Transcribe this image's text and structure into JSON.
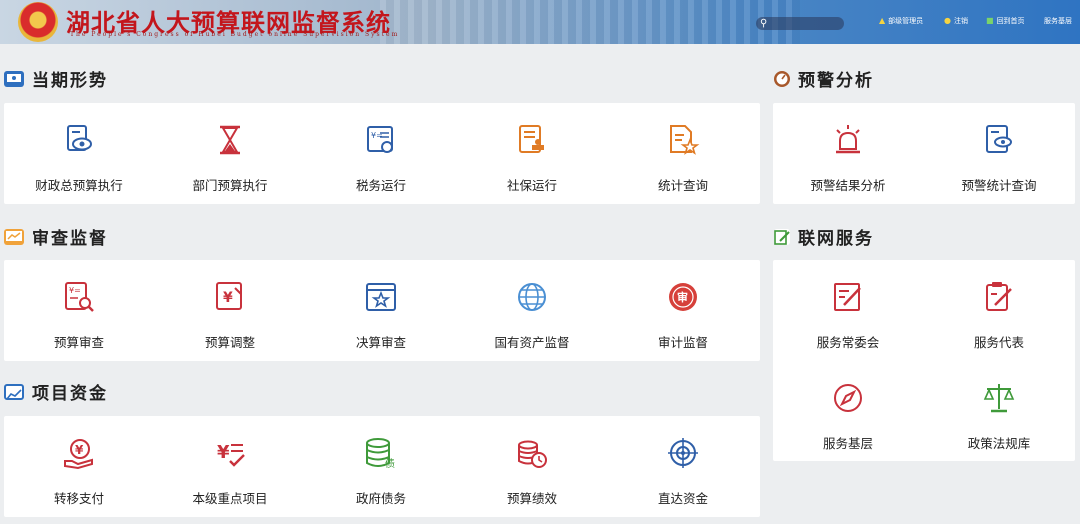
{
  "header": {
    "title": "湖北省人大预算联网监督系统",
    "subtitle": "The People's Congress of Hubei Budget online Supervision System",
    "nav": [
      {
        "label": "部级管理员",
        "icon": "user-warning-icon"
      },
      {
        "label": "注销",
        "icon": "power-icon"
      },
      {
        "label": "回到首页",
        "icon": "home-icon"
      },
      {
        "label": "服务基层",
        "icon": ""
      }
    ]
  },
  "sections": {
    "current": {
      "title": "当期形势",
      "items": [
        "财政总预算执行",
        "部门预算执行",
        "税务运行",
        "社保运行",
        "统计查询"
      ]
    },
    "review": {
      "title": "审查监督",
      "items": [
        "预算审查",
        "预算调整",
        "决算审查",
        "国有资产监督",
        "审计监督"
      ]
    },
    "funds": {
      "title": "项目资金",
      "items": [
        "转移支付",
        "本级重点项目",
        "政府债务",
        "预算绩效",
        "直达资金"
      ]
    },
    "warning": {
      "title": "预警分析",
      "items": [
        "预警结果分析",
        "预警统计查询"
      ]
    },
    "service": {
      "title": "联网服务",
      "items": [
        "服务常委会",
        "服务代表",
        "服务基层",
        "政策法规库"
      ]
    }
  },
  "colors": {
    "brand_red": "#c3161c",
    "icon_blue": "#2f5fa8",
    "icon_orange": "#e07b25",
    "icon_green": "#3f9a3a"
  }
}
